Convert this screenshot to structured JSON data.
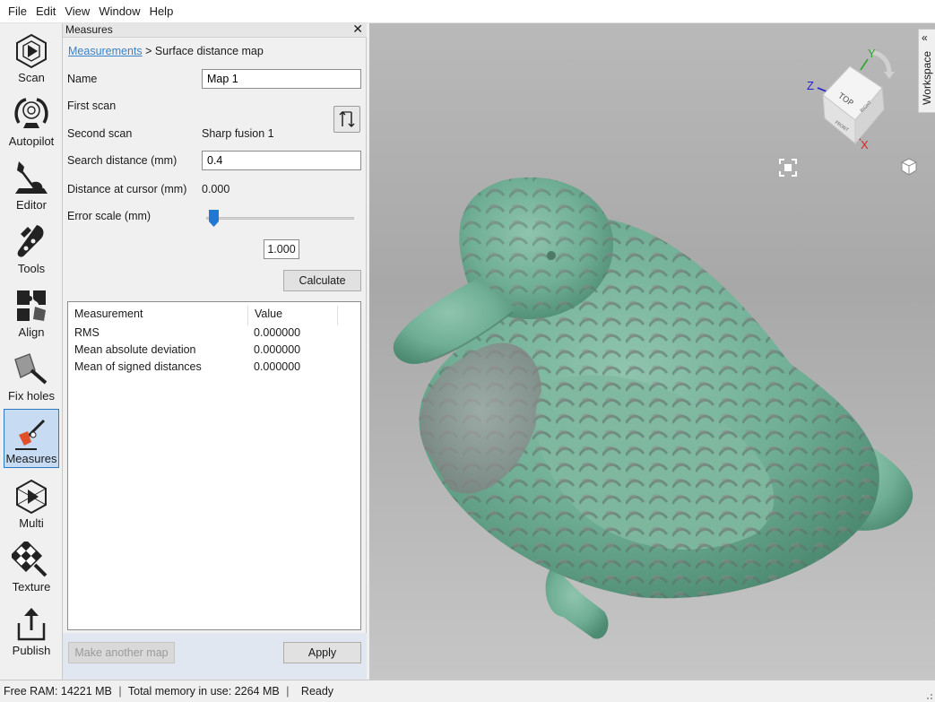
{
  "menu": [
    "File",
    "Edit",
    "View",
    "Window",
    "Help"
  ],
  "tools": [
    {
      "label": "Scan",
      "icon": "scan-icon"
    },
    {
      "label": "Autopilot",
      "icon": "autopilot-icon"
    },
    {
      "label": "Editor",
      "icon": "editor-icon"
    },
    {
      "label": "Tools",
      "icon": "tools-icon"
    },
    {
      "label": "Align",
      "icon": "align-icon"
    },
    {
      "label": "Fix holes",
      "icon": "fix-holes-icon"
    },
    {
      "label": "Measures",
      "icon": "measures-icon",
      "active": true
    },
    {
      "label": "Multi",
      "icon": "multi-icon"
    },
    {
      "label": "Texture",
      "icon": "texture-icon"
    },
    {
      "label": "Publish",
      "icon": "publish-icon"
    }
  ],
  "panel": {
    "title": "Measures",
    "breadcrumb_link": "Measurements",
    "breadcrumb_current": " > Surface distance map",
    "name_label": "Name",
    "name_value": "Map 1",
    "first_scan_label": "First scan",
    "second_scan_label": "Second scan",
    "second_scan_value": "Sharp fusion 1",
    "search_distance_label": "Search distance (mm)",
    "search_distance_value": "0.4",
    "distance_cursor_label": "Distance at cursor (mm)",
    "distance_cursor_value": "0.000",
    "error_scale_label": "Error scale (mm)",
    "error_scale_value": "1.000",
    "error_scale_slider_fraction": 0.02,
    "calculate_label": "Calculate",
    "table": {
      "headers": [
        "Measurement",
        "Value"
      ],
      "rows": [
        [
          "RMS",
          "0.000000"
        ],
        [
          "Mean absolute deviation",
          "0.000000"
        ],
        [
          "Mean of signed distances",
          "0.000000"
        ]
      ]
    },
    "make_another_label": "Make another map",
    "apply_label": "Apply"
  },
  "viewport": {
    "workspace_label": "Workspace",
    "axis_x": "X",
    "axis_y": "Y",
    "axis_z": "Z",
    "cube_top": "TOP",
    "cube_right": "RIGHT",
    "cube_front": "FRONT",
    "colors": {
      "x": "#e02020",
      "y": "#2fa52f",
      "z": "#2020d0",
      "model": "#6fae95"
    }
  },
  "status": {
    "free_ram": "Free RAM: 14221 MB",
    "total_memory": "Total memory in use: 2264 MB",
    "state": "Ready"
  }
}
